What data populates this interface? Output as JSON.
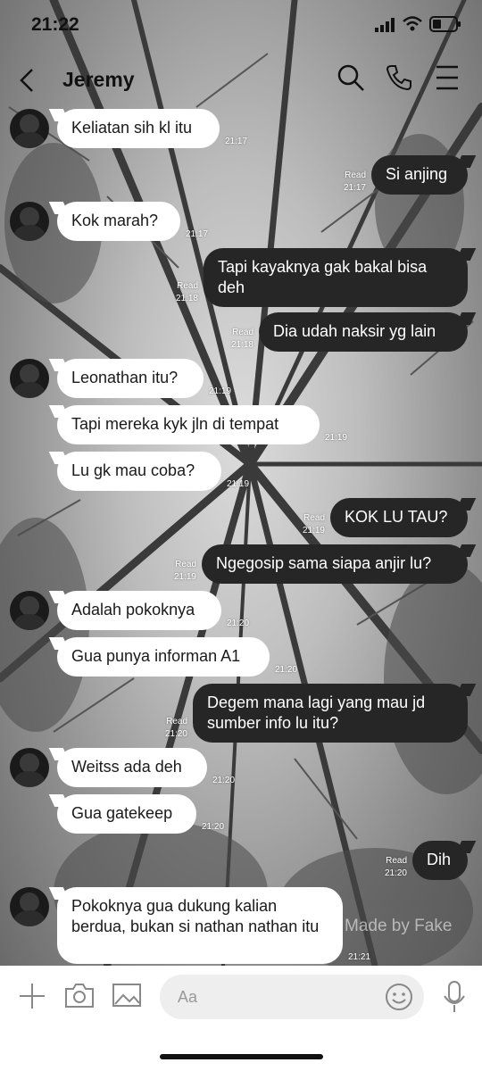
{
  "status": {
    "time": "21:22"
  },
  "header": {
    "title": "Jeremy"
  },
  "messages": [
    {
      "side": "in",
      "text": "Keliatan sih kl itu",
      "time": "21:17"
    },
    {
      "side": "out",
      "text": "Si anjing",
      "time": "21:17",
      "read": "Read"
    },
    {
      "side": "in",
      "text": "Kok marah?",
      "time": "21:17"
    },
    {
      "side": "out",
      "text": "Tapi kayaknya gak bakal bisa deh",
      "time": "21:18",
      "read": "Read"
    },
    {
      "side": "out",
      "text": "Dia udah naksir yg lain",
      "time": "21:18",
      "read": "Read"
    },
    {
      "side": "in",
      "text": "Leonathan itu?",
      "time": "21:19"
    },
    {
      "side": "in",
      "text": "Tapi mereka kyk jln di tempat",
      "time": "21:19"
    },
    {
      "side": "in",
      "text": "Lu gk mau coba?",
      "time": "21:19"
    },
    {
      "side": "out",
      "text": "KOK LU TAU?",
      "time": "21:19",
      "read": "Read"
    },
    {
      "side": "out",
      "text": "Ngegosip sama siapa anjir lu?",
      "time": "21:19",
      "read": "Read"
    },
    {
      "side": "in",
      "text": "Adalah pokoknya",
      "time": "21:20"
    },
    {
      "side": "in",
      "text": "Gua punya informan A1",
      "time": "21:20"
    },
    {
      "side": "out",
      "text": "Degem mana lagi yang mau jd sumber info lu itu?",
      "time": "21:20",
      "read": "Read"
    },
    {
      "side": "in",
      "text": "Weitss ada deh",
      "time": "21:20"
    },
    {
      "side": "in",
      "text": "Gua gatekeep",
      "time": "21:20"
    },
    {
      "side": "out",
      "text": "Dih",
      "time": "21:20",
      "read": "Read"
    },
    {
      "side": "in",
      "text": "Pokoknya gua dukung kalian berdua, bukan si nathan nathan itu",
      "time": "21:21"
    }
  ],
  "watermark": "Made by Fake",
  "composer": {
    "placeholder": "Aa"
  },
  "icons": [
    "back-icon",
    "search-icon",
    "phone-icon",
    "menu-icon",
    "plus-icon",
    "camera-icon",
    "image-icon",
    "emoji-icon",
    "microphone-icon"
  ]
}
